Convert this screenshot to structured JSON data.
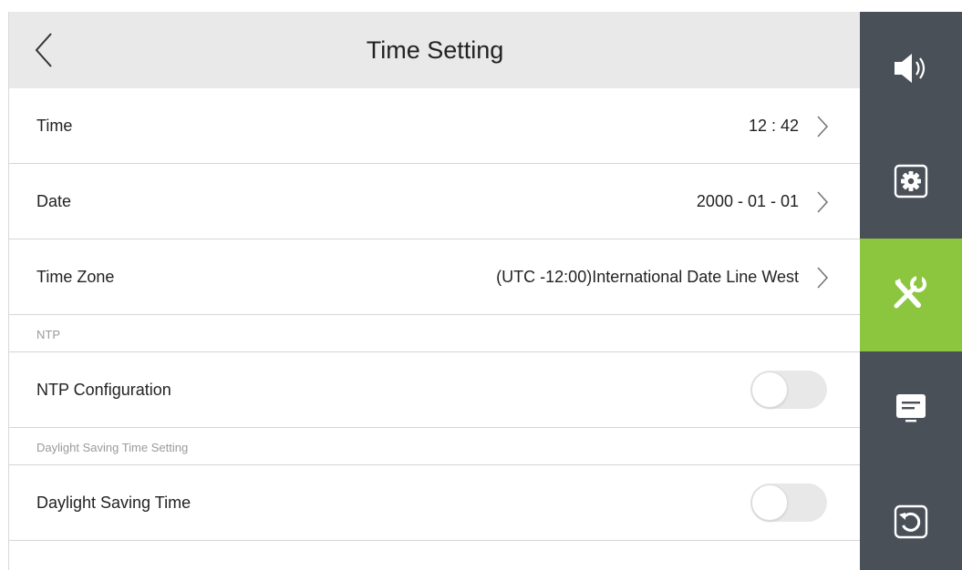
{
  "header": {
    "title": "Time Setting"
  },
  "rows": {
    "time": {
      "label": "Time",
      "value": "12 : 42"
    },
    "date": {
      "label": "Date",
      "value": "2000 - 01 - 01"
    },
    "timezone": {
      "label": "Time Zone",
      "value": "(UTC -12:00)International Date Line West"
    },
    "ntp_section": {
      "label": "NTP"
    },
    "ntp_config": {
      "label": "NTP Configuration",
      "toggle_on": false
    },
    "dst_section": {
      "label": "Daylight Saving Time Setting"
    },
    "dst": {
      "label": "Daylight Saving Time",
      "toggle_on": false
    }
  },
  "sidebar": {
    "items": [
      {
        "icon": "speaker-icon",
        "active": false
      },
      {
        "icon": "gear-icon",
        "active": false
      },
      {
        "icon": "tools-icon",
        "active": true
      },
      {
        "icon": "message-icon",
        "active": false
      },
      {
        "icon": "restore-icon",
        "active": false
      }
    ]
  },
  "colors": {
    "sidebar_bg": "#4a5058",
    "sidebar_active": "#8cc63f",
    "header_bg": "#e9e9e9",
    "toggle_off": "#e8e8e8"
  }
}
